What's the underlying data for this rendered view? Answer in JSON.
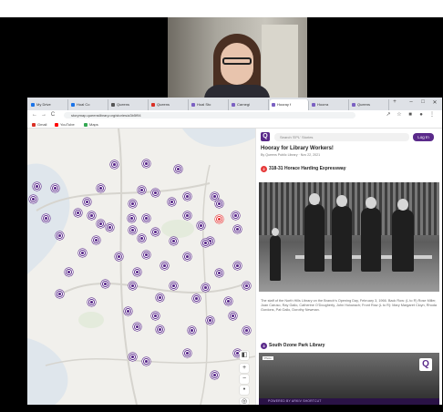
{
  "browser": {
    "tabs": [
      {
        "label": "My Drive",
        "active": false
      },
      {
        "label": "Hoal Co",
        "active": false
      },
      {
        "label": "Queens",
        "active": false
      },
      {
        "label": "Queens",
        "active": false
      },
      {
        "label": "Hoal Sto",
        "active": false
      },
      {
        "label": "Carnegi",
        "active": false
      },
      {
        "label": "Hooray f",
        "active": true
      },
      {
        "label": "Hoorra",
        "active": false
      },
      {
        "label": "Queens",
        "active": false
      }
    ],
    "new_tab": "+",
    "window_controls": {
      "minimize": "–",
      "maximize": "□",
      "close": "✕"
    },
    "nav": {
      "back": "←",
      "forward": "→",
      "reload": "C"
    },
    "url": "storymap.queenslibrary.org/stories/a3b5f94",
    "bookmarks": [
      {
        "label": "Gmail",
        "color": "#d93025"
      },
      {
        "label": "YouTube",
        "color": "#ff0000"
      },
      {
        "label": "Maps",
        "color": "#34a853"
      }
    ]
  },
  "map": {
    "zoom_in": "+",
    "zoom_out": "−",
    "compass": "•",
    "layers": "◧",
    "locate": "◎",
    "pin_color": "#5a2a8a",
    "active_pin_color": "#e63a3a"
  },
  "story": {
    "logo": "Q",
    "search_placeholder": "Search 'EPL' Stories",
    "login": "Log In",
    "title": "Hooray for Library Workers!",
    "byline": "By Queens Public Library · Nov 22, 2021",
    "chapters": [
      {
        "number": "2",
        "title": "318-31 Horace Harding Expressway",
        "color": "#e63a3a"
      },
      {
        "number": "3",
        "title": "South Ozone Park Library",
        "color": "#5a2a8a"
      }
    ],
    "caption": "The staff of the North Hills Library on the Branch's Opening Day, February 3, 1966. Back Row: (L to R) Rose Miller, Joan Caruso, Ray Gallo, Catherine O'Dougherty, John Holowach; Front Row (L to R): Mary Margaret Cloyn, Rhoda Gordons, Pat Gallo, Dorothy Newman.",
    "photo2_tag": "Photo",
    "photo2_badge": "Q",
    "powered_by": "POWERED BY  ARKIV  SHORTCUT"
  }
}
